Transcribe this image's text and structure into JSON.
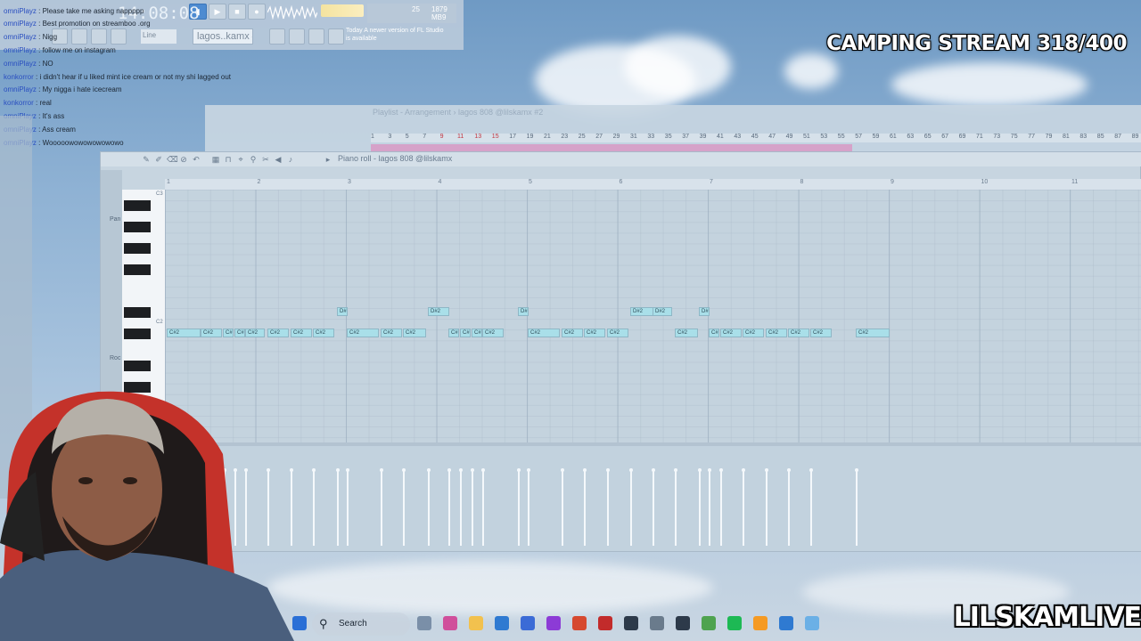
{
  "stream": {
    "title": "CAMPING STREAM 318/400",
    "channel": "LILSKAMLIVE"
  },
  "fl_toolbar": {
    "time_display": "14:08:08",
    "pattern_name": "lagos..kamx #2",
    "snap_label": "Line",
    "cpu_value": "25",
    "memory_value": "1879 MB",
    "polyphony_value": "9",
    "news_text": "Today  A newer version of FL Studio is available"
  },
  "chat": [
    {
      "user": "omniPlayz",
      "text": "Please take me asking nappppp"
    },
    {
      "user": "omniPlayz",
      "text": "Best promotion on streamboo .org"
    },
    {
      "user": "omniPlayz",
      "text": "Nigg"
    },
    {
      "user": "omniPlayz",
      "text": "follow me on instagram"
    },
    {
      "user": "omniPlayz",
      "text": "NO"
    },
    {
      "user": "konkorror",
      "text": "i didn't hear if u liked mint ice cream or not my shi lagged out"
    },
    {
      "user": "omniPlayz",
      "text": "My nigga i hate icecream"
    },
    {
      "user": "konkorror",
      "text": "real"
    },
    {
      "user": "omniPlayz",
      "text": "It's ass"
    },
    {
      "user": "omniPlayz",
      "text": "Ass cream"
    },
    {
      "user": "omniPlayz",
      "text": "Wooooowowowowowowo"
    }
  ],
  "playlist": {
    "title": "Playlist - Arrangement › lagos 808 @lilskamx #2",
    "bars": [
      "1",
      "3",
      "5",
      "7",
      "9",
      "11",
      "13",
      "15",
      "17",
      "19",
      "21",
      "23",
      "25",
      "27",
      "29",
      "31",
      "33",
      "35",
      "37",
      "39",
      "41",
      "43",
      "45",
      "47",
      "49",
      "51",
      "53",
      "55",
      "57",
      "59",
      "61",
      "63",
      "65",
      "67",
      "69",
      "71",
      "73",
      "75",
      "77",
      "79",
      "81",
      "83",
      "85",
      "87",
      "89"
    ]
  },
  "piano_roll": {
    "title": "Piano roll - lagos 808 @lilskamx",
    "bar_numbers": [
      "1",
      "2",
      "3",
      "4",
      "5",
      "6",
      "7",
      "8",
      "9",
      "10",
      "11"
    ],
    "octave_labels": [
      "C3",
      "C2"
    ],
    "side_labels": [
      "Pan",
      "Roc"
    ],
    "note_label_upper": "D#2",
    "note_label_lower": "C#2"
  },
  "taskbar": {
    "search_label": "Search"
  }
}
